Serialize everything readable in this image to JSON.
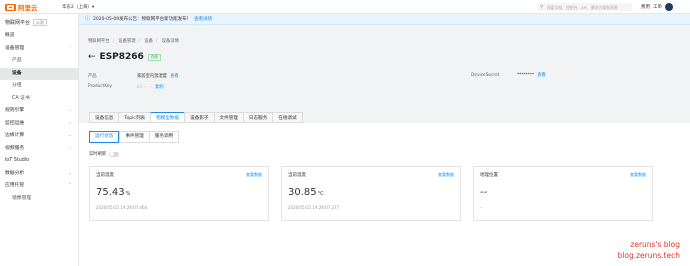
{
  "topbar": {
    "logo_text": "阿里云",
    "region": "华东2（上海）▾",
    "search_placeholder": "搜索文档、控制台、API、解决方案和资源",
    "links": [
      "费用",
      "工单"
    ]
  },
  "sidebar": {
    "title": "物联网平台",
    "title_tag": "公测",
    "items": [
      {
        "label": "概览",
        "level": 0,
        "active": false,
        "chevron": ""
      },
      {
        "label": "设备管理",
        "level": 0,
        "active": false,
        "chevron": "⌃"
      },
      {
        "label": "产品",
        "level": 1,
        "active": false,
        "chevron": ""
      },
      {
        "label": "设备",
        "level": 1,
        "active": true,
        "chevron": ""
      },
      {
        "label": "分组",
        "level": 1,
        "active": false,
        "chevron": ""
      },
      {
        "label": "CA 证书",
        "level": 1,
        "active": false,
        "chevron": ""
      },
      {
        "label": "规则引擎",
        "level": 0,
        "active": false,
        "chevron": "⌄"
      },
      {
        "label": "监控运维",
        "level": 0,
        "active": false,
        "chevron": "⌄"
      },
      {
        "label": "边缘计算",
        "level": 0,
        "active": false,
        "chevron": "⌄"
      },
      {
        "label": "视频服务",
        "level": 0,
        "active": false,
        "chevron": "⌄"
      },
      {
        "label": "IoT Studio",
        "level": 0,
        "active": false,
        "chevron": ""
      },
      {
        "label": "数据分析",
        "level": 0,
        "active": false,
        "chevron": "⌄"
      },
      {
        "label": "应用托管",
        "level": 0,
        "active": false,
        "chevron": "⌃"
      },
      {
        "label": "镜像管理",
        "level": 1,
        "active": false,
        "chevron": ""
      }
    ]
  },
  "notice": {
    "text": "2020-05-09发布公告：物联网平台新功能发布！",
    "link": "查看详情"
  },
  "breadcrumb": [
    "物联网平台",
    "设备管理",
    "设备",
    "设备详情"
  ],
  "device": {
    "name": "ESP8266",
    "status": "在线",
    "product_label": "产品",
    "product_value": "家居室内温湿度",
    "product_link": "查看",
    "productkey_label": "ProductKey",
    "productkey_value": "a1··· ···",
    "productkey_link": "复制",
    "secret_label": "DeviceSecret",
    "secret_value": "********",
    "secret_link": "查看"
  },
  "tabs": [
    "设备信息",
    "Topic列表",
    "物模型数据",
    "设备影子",
    "文件管理",
    "日志服务",
    "在线调试"
  ],
  "active_tab": 2,
  "subtabs": [
    "运行状态",
    "事件管理",
    "服务调用"
  ],
  "active_subtab": 0,
  "realtime_label": "实时刷新",
  "cards": [
    {
      "label": "当前温度",
      "link": "查看数据",
      "value": "75.43",
      "unit": "%",
      "time": "2020/05/15 19:28:07.464"
    },
    {
      "label": "当前温度",
      "link": "查看数据",
      "value": "30.85",
      "unit": "°C",
      "time": "2020/05/15 19:28:07.277"
    },
    {
      "label": "地理位置",
      "link": "查看数据",
      "value": "--",
      "unit": "",
      "time": "--"
    }
  ],
  "watermark": [
    "zeruns's blog",
    "blog.zeruns.tech"
  ],
  "colors": {
    "accent": "#1b8cf0",
    "brand": "#ff6a00",
    "online": "#2aa144",
    "watermark": "#e8322a"
  }
}
